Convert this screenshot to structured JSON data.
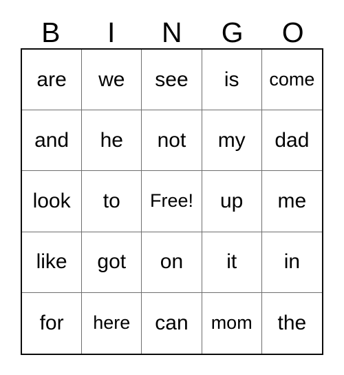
{
  "card": {
    "title": "Bingo Card",
    "background_color": "#ffffff",
    "text_color": "#000000",
    "outer_border_color": "#0a0a0a",
    "inner_border_color": "#6e6e6e"
  },
  "header": {
    "letters": [
      "B",
      "I",
      "N",
      "G",
      "O"
    ]
  },
  "grid": {
    "columns": 5,
    "rows": 5,
    "free_space": "Free!",
    "free_space_position": {
      "row": 2,
      "column": 2
    },
    "cells": [
      [
        "are",
        "we",
        "see",
        "is",
        "come"
      ],
      [
        "and",
        "he",
        "not",
        "my",
        "dad"
      ],
      [
        "look",
        "to",
        "Free!",
        "up",
        "me"
      ],
      [
        "like",
        "got",
        "on",
        "it",
        "in"
      ],
      [
        "for",
        "here",
        "can",
        "mom",
        "the"
      ]
    ]
  }
}
